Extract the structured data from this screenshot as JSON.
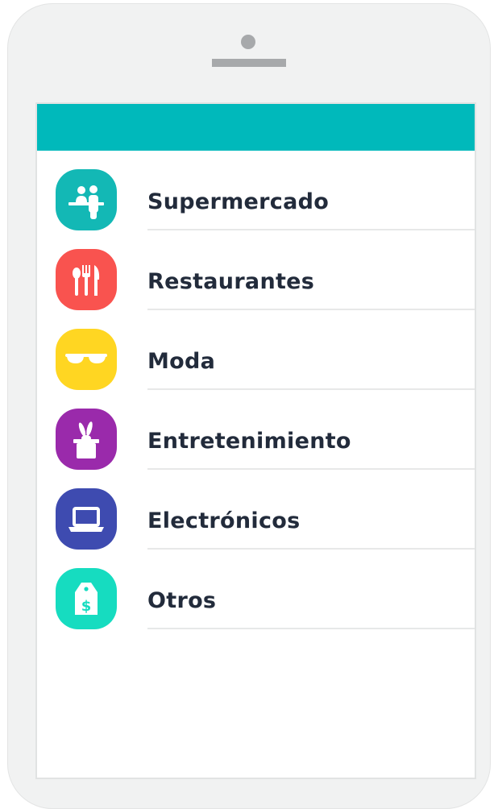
{
  "categories": [
    {
      "label": "Supermercado",
      "icon": "cashier-icon",
      "color": "#13b8b5"
    },
    {
      "label": "Restaurantes",
      "icon": "cutlery-icon",
      "color": "#f9534f"
    },
    {
      "label": "Moda",
      "icon": "sunglasses-icon",
      "color": "#ffd622"
    },
    {
      "label": "Entretenimiento",
      "icon": "magic-hat-rabbit-icon",
      "color": "#9a2aab"
    },
    {
      "label": "Electrónicos",
      "icon": "laptop-icon",
      "color": "#3e4bb0"
    },
    {
      "label": "Otros",
      "icon": "price-tag-icon",
      "color": "#16dcc0"
    }
  ]
}
